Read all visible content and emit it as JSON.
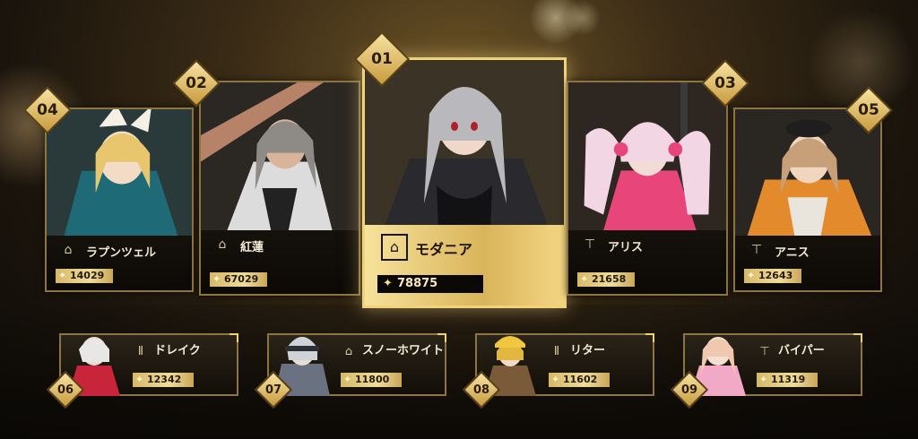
{
  "featured": {
    "rank": "01",
    "name": "モダニア",
    "power": "78875",
    "class_icon": "attacker-icon",
    "hair": "#b9b9bd",
    "accent": "#c8a24a"
  },
  "top_cards": [
    {
      "rank": "04",
      "name": "ラプンツェル",
      "power": "14029",
      "class_icon": "attacker-icon",
      "hair": "#e7c66d",
      "outfit": "#1e6b77"
    },
    {
      "rank": "02",
      "name": "紅蓮",
      "power": "67029",
      "class_icon": "attacker-icon",
      "hair": "#8e8a86",
      "outfit": "#dcdcdc"
    },
    {
      "rank": "03",
      "name": "アリス",
      "power": "21658",
      "class_icon": "tank-icon",
      "hair": "#f2d6e4",
      "outfit": "#e8457a"
    },
    {
      "rank": "05",
      "name": "アニス",
      "power": "12643",
      "class_icon": "tank-icon",
      "hair": "#c7a07a",
      "outfit": "#e38a2c"
    }
  ],
  "bottom_cards": [
    {
      "rank": "06",
      "name": "ドレイク",
      "power": "12342",
      "class_icon": "supporter-icon",
      "hair": "#e9e6e6",
      "outfit": "#c8253a"
    },
    {
      "rank": "07",
      "name": "スノーホワイト",
      "power": "11800",
      "class_icon": "attacker-icon",
      "hair": "#cfd2d6",
      "outfit": "#6a7180"
    },
    {
      "rank": "08",
      "name": "リター",
      "power": "11602",
      "class_icon": "supporter-icon",
      "hair": "#e3b640",
      "outfit": "#7a5a38"
    },
    {
      "rank": "09",
      "name": "バイパー",
      "power": "11319",
      "class_icon": "tank-icon",
      "hair": "#f0c8b0",
      "outfit": "#f2a9c6"
    }
  ],
  "colors": {
    "gold": "#f0d27a",
    "frame": "#8c7443",
    "background": "#1a140c"
  }
}
